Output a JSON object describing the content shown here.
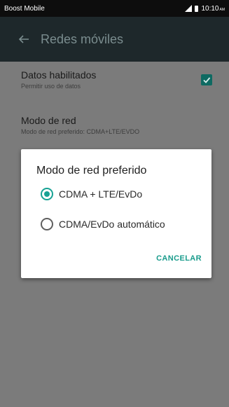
{
  "status_bar": {
    "carrier": "Boost Mobile",
    "time": "10:10",
    "ampm": "AM"
  },
  "toolbar": {
    "title": "Redes móviles"
  },
  "settings": {
    "data_enabled": {
      "title": "Datos habilitados",
      "summary": "Permitir uso de datos",
      "checked": true
    },
    "network_mode": {
      "title": "Modo de red",
      "summary": "Modo de red preferido: CDMA+LTE/EVDO"
    }
  },
  "dialog": {
    "title": "Modo de red preferido",
    "options": [
      {
        "label": "CDMA + LTE/EvDo",
        "selected": true
      },
      {
        "label": "CDMA/EvDo automático",
        "selected": false
      }
    ],
    "cancel_label": "CANCELAR"
  },
  "colors": {
    "accent": "#17a294",
    "toolbar": "#1e282b",
    "scrim": "#7b7b7b",
    "checkbox": "#0e6a62"
  },
  "icons": {
    "back": "arrow-left-icon",
    "signal": "signal-icon",
    "battery": "battery-icon",
    "check": "checkmark-icon"
  }
}
